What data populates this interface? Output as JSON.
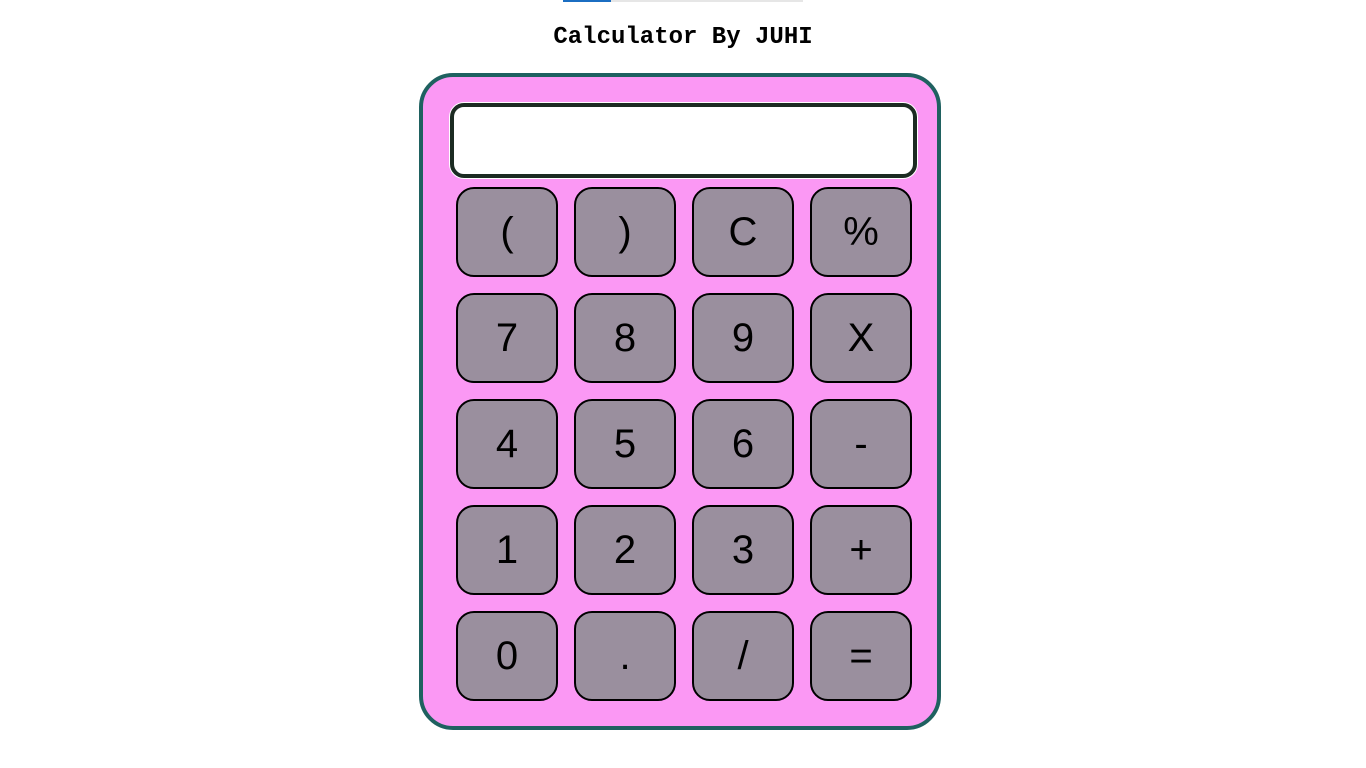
{
  "title": "Calculator By JUHI",
  "display": {
    "value": ""
  },
  "colors": {
    "body_background": "#fb98f4",
    "body_border": "#1f6160",
    "key_background": "#9a8f9e",
    "display_border": "#1c2b22"
  },
  "keys": {
    "open_paren": "(",
    "close_paren": ")",
    "clear": "C",
    "percent": "%",
    "seven": "7",
    "eight": "8",
    "nine": "9",
    "multiply": "X",
    "four": "4",
    "five": "5",
    "six": "6",
    "subtract": "-",
    "one": "1",
    "two": "2",
    "three": "3",
    "add": "+",
    "zero": "0",
    "decimal": ".",
    "divide": "/",
    "equals": "="
  }
}
